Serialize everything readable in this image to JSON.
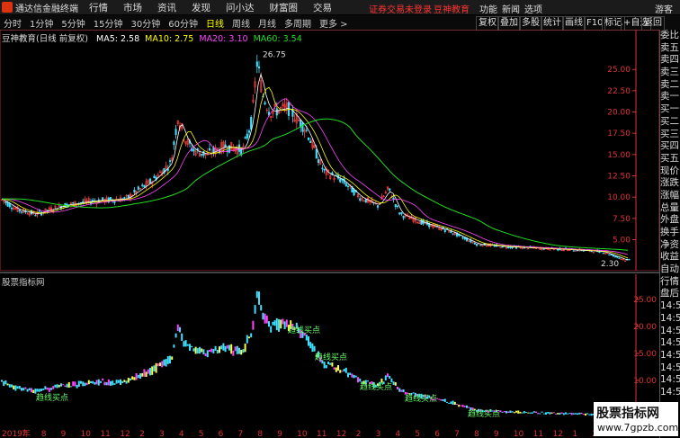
{
  "app": {
    "title": "通达信金融终端"
  },
  "menu": [
    {
      "label": "行情"
    },
    {
      "label": "市场"
    },
    {
      "label": "资讯"
    },
    {
      "label": "发现"
    },
    {
      "label": "问小达"
    },
    {
      "label": "财富圈"
    },
    {
      "label": "交易"
    }
  ],
  "alert": "证券交易未登录",
  "alert2": "豆神教育",
  "right_menu": [
    "功能",
    "新闻",
    "选项",
    "游客"
  ],
  "periods": [
    "分时",
    "1分钟",
    "5分钟",
    "15分钟",
    "30分钟",
    "60分钟",
    "日线",
    "周线",
    "月线",
    "多周期",
    "更多 >"
  ],
  "active_period": "日线",
  "toolbuttons": [
    "复权",
    "叠加",
    "多股",
    "统计",
    "画线",
    "F10",
    "标记",
    "+自选",
    "返回"
  ],
  "main": {
    "header": "豆神教育(日线 前复权)",
    "ma": [
      {
        "label": "MA5: 2.58",
        "color": "#ffffff"
      },
      {
        "label": "MA10: 2.75",
        "color": "#ffff00"
      },
      {
        "label": "MA20: 3.10",
        "color": "#ff44ff"
      },
      {
        "label": "MA60: 3.54",
        "color": "#22dd22"
      }
    ],
    "high_label": "26.75",
    "low_label": "2.30",
    "yticks": [
      "25.00",
      "22.50",
      "20.00",
      "17.50",
      "15.00",
      "12.50",
      "10.00",
      "7.50",
      "5.00"
    ]
  },
  "sub": {
    "title": "股票指标网",
    "yticks": [
      "25.00",
      "20.00",
      "15.00",
      "10.00"
    ],
    "annotations": [
      "趋线买点",
      "趋线买点",
      "趋线买点",
      "趋线买点",
      "趋线买点",
      "趋线买点"
    ]
  },
  "xaxis": [
    "2019年",
    "7",
    "8",
    "9",
    "10",
    "11",
    "12",
    "2",
    "3",
    "4",
    "5",
    "6",
    "7",
    "8",
    "9",
    "10",
    "11",
    "12",
    "2",
    "3",
    "4",
    "5",
    "6",
    "7",
    "8",
    "9",
    "10",
    "11",
    "12",
    "1",
    "2",
    "3"
  ],
  "sidebar": [
    "委比",
    "卖五",
    "卖四",
    "卖三",
    "卖二",
    "卖一",
    "买一",
    "买二",
    "买三",
    "买四",
    "买五",
    "现价",
    "涨跌",
    "涨幅",
    "总量",
    "外盘",
    "换手",
    "净资",
    "收益",
    "自动",
    "行情",
    "盘后",
    "14:5",
    "14:5",
    "14:5",
    "14:5",
    "14:5",
    "14:5",
    "14:5",
    "14:5"
  ],
  "watermark": {
    "line1": "股票指标网",
    "line2": "www.7gpzb.com"
  }
}
